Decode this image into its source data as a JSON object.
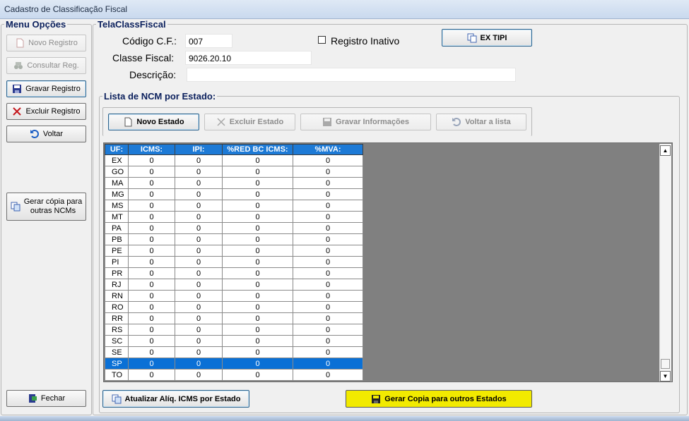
{
  "window": {
    "title": "Cadastro de Classificação Fiscal"
  },
  "menu": {
    "title": "Menu Opções",
    "novo_registro": "Novo Registro",
    "consultar": "Consultar Reg.",
    "gravar": "Gravar Registro",
    "excluir": "Excluir Registro",
    "voltar": "Voltar",
    "gerar_copia_l1": "Gerar cópia para",
    "gerar_copia_l2": "outras NCMs",
    "fechar": "Fechar"
  },
  "form": {
    "title": "TelaClassFiscal",
    "codigo_label": "Código C.F.:",
    "codigo_value": "007",
    "classe_label": "Classe Fiscal:",
    "classe_value": "9026.20.10",
    "descricao_label": "Descrição:",
    "descricao_value": "",
    "registro_inativo_label": "Registro Inativo",
    "ex_tipi": "EX TIPI"
  },
  "ncm": {
    "title": "Lista de NCM por Estado:",
    "novo_estado": "Novo Estado",
    "excluir_estado": "Excluir Estado",
    "gravar_info": "Gravar Informações",
    "voltar_lista": "Voltar a lista",
    "columns": [
      "UF:",
      "ICMS:",
      "IPI:",
      "%RED BC ICMS:",
      "%MVA:"
    ],
    "rows": [
      [
        "EX",
        "0",
        "0",
        "0",
        "0"
      ],
      [
        "GO",
        "0",
        "0",
        "0",
        "0"
      ],
      [
        "MA",
        "0",
        "0",
        "0",
        "0"
      ],
      [
        "MG",
        "0",
        "0",
        "0",
        "0"
      ],
      [
        "MS",
        "0",
        "0",
        "0",
        "0"
      ],
      [
        "MT",
        "0",
        "0",
        "0",
        "0"
      ],
      [
        "PA",
        "0",
        "0",
        "0",
        "0"
      ],
      [
        "PB",
        "0",
        "0",
        "0",
        "0"
      ],
      [
        "PE",
        "0",
        "0",
        "0",
        "0"
      ],
      [
        "PI",
        "0",
        "0",
        "0",
        "0"
      ],
      [
        "PR",
        "0",
        "0",
        "0",
        "0"
      ],
      [
        "RJ",
        "0",
        "0",
        "0",
        "0"
      ],
      [
        "RN",
        "0",
        "0",
        "0",
        "0"
      ],
      [
        "RO",
        "0",
        "0",
        "0",
        "0"
      ],
      [
        "RR",
        "0",
        "0",
        "0",
        "0"
      ],
      [
        "RS",
        "0",
        "0",
        "0",
        "0"
      ],
      [
        "SC",
        "0",
        "0",
        "0",
        "0"
      ],
      [
        "SE",
        "0",
        "0",
        "0",
        "0"
      ],
      [
        "SP",
        "0",
        "0",
        "0",
        "0"
      ],
      [
        "TO",
        "0",
        "0",
        "0",
        "0"
      ]
    ],
    "selected_uf": "SP",
    "atualizar": "Atualizar Alíq. ICMS por Estado",
    "gerar_copia_estados": "Gerar Copia para outros Estados"
  }
}
